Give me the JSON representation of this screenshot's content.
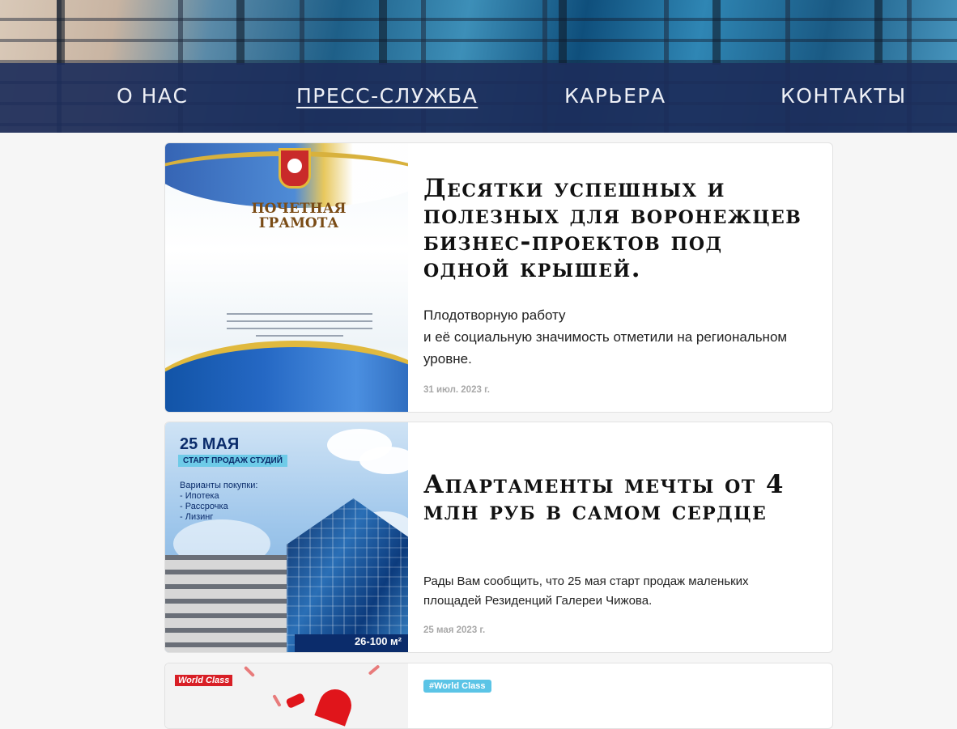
{
  "nav": {
    "items": [
      {
        "label": "О НАС"
      },
      {
        "label": "ПРЕСС-СЛУЖБА"
      },
      {
        "label": "КАРЬЕРА"
      },
      {
        "label": "КОНТАКТЫ"
      }
    ],
    "active_index": 1
  },
  "posts": [
    {
      "title": "Десятки успешных и полезных для воронежцев бизнес-проектов под одной крышей.",
      "text": "Плодотворную работу\nи её социальную значимость отметили на региональном уровне.",
      "date": "31 июл. 2023 г.",
      "image": {
        "heading": "ПОЧЕТНАЯ\nГРАМОТА"
      }
    },
    {
      "title": "Апартаменты мечты от 4 млн руб в самом сердце",
      "text": "Рады Вам сообщить, что 25 мая старт продаж маленьких площадей Резиденций Галереи Чижова.",
      "date": "25 мая 2023 г.",
      "image": {
        "date": "25 МАЯ",
        "tag": "СТАРТ ПРОДАЖ СТУДИЙ",
        "options": "Варианты покупки:\n- Ипотека\n- Рассрочка\n- Лизинг",
        "area": "26-100 м²"
      }
    },
    {
      "hashtag": "#World Class",
      "image": {
        "logo": "World Class"
      }
    }
  ]
}
